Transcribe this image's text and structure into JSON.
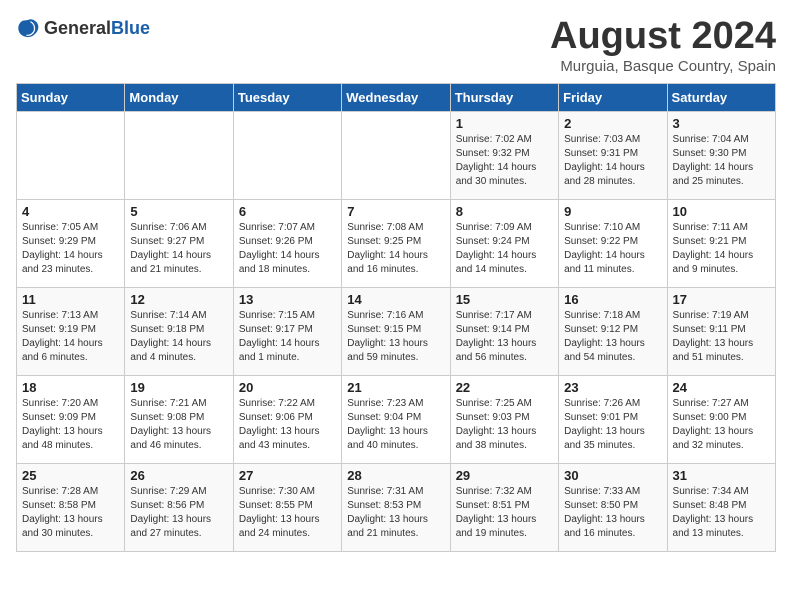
{
  "logo": {
    "general": "General",
    "blue": "Blue"
  },
  "title": "August 2024",
  "subtitle": "Murguia, Basque Country, Spain",
  "days_of_week": [
    "Sunday",
    "Monday",
    "Tuesday",
    "Wednesday",
    "Thursday",
    "Friday",
    "Saturday"
  ],
  "weeks": [
    [
      {
        "day": "",
        "sunrise": "",
        "sunset": "",
        "daylight": ""
      },
      {
        "day": "",
        "sunrise": "",
        "sunset": "",
        "daylight": ""
      },
      {
        "day": "",
        "sunrise": "",
        "sunset": "",
        "daylight": ""
      },
      {
        "day": "",
        "sunrise": "",
        "sunset": "",
        "daylight": ""
      },
      {
        "day": "1",
        "sunrise": "Sunrise: 7:02 AM",
        "sunset": "Sunset: 9:32 PM",
        "daylight": "Daylight: 14 hours and 30 minutes."
      },
      {
        "day": "2",
        "sunrise": "Sunrise: 7:03 AM",
        "sunset": "Sunset: 9:31 PM",
        "daylight": "Daylight: 14 hours and 28 minutes."
      },
      {
        "day": "3",
        "sunrise": "Sunrise: 7:04 AM",
        "sunset": "Sunset: 9:30 PM",
        "daylight": "Daylight: 14 hours and 25 minutes."
      }
    ],
    [
      {
        "day": "4",
        "sunrise": "Sunrise: 7:05 AM",
        "sunset": "Sunset: 9:29 PM",
        "daylight": "Daylight: 14 hours and 23 minutes."
      },
      {
        "day": "5",
        "sunrise": "Sunrise: 7:06 AM",
        "sunset": "Sunset: 9:27 PM",
        "daylight": "Daylight: 14 hours and 21 minutes."
      },
      {
        "day": "6",
        "sunrise": "Sunrise: 7:07 AM",
        "sunset": "Sunset: 9:26 PM",
        "daylight": "Daylight: 14 hours and 18 minutes."
      },
      {
        "day": "7",
        "sunrise": "Sunrise: 7:08 AM",
        "sunset": "Sunset: 9:25 PM",
        "daylight": "Daylight: 14 hours and 16 minutes."
      },
      {
        "day": "8",
        "sunrise": "Sunrise: 7:09 AM",
        "sunset": "Sunset: 9:24 PM",
        "daylight": "Daylight: 14 hours and 14 minutes."
      },
      {
        "day": "9",
        "sunrise": "Sunrise: 7:10 AM",
        "sunset": "Sunset: 9:22 PM",
        "daylight": "Daylight: 14 hours and 11 minutes."
      },
      {
        "day": "10",
        "sunrise": "Sunrise: 7:11 AM",
        "sunset": "Sunset: 9:21 PM",
        "daylight": "Daylight: 14 hours and 9 minutes."
      }
    ],
    [
      {
        "day": "11",
        "sunrise": "Sunrise: 7:13 AM",
        "sunset": "Sunset: 9:19 PM",
        "daylight": "Daylight: 14 hours and 6 minutes."
      },
      {
        "day": "12",
        "sunrise": "Sunrise: 7:14 AM",
        "sunset": "Sunset: 9:18 PM",
        "daylight": "Daylight: 14 hours and 4 minutes."
      },
      {
        "day": "13",
        "sunrise": "Sunrise: 7:15 AM",
        "sunset": "Sunset: 9:17 PM",
        "daylight": "Daylight: 14 hours and 1 minute."
      },
      {
        "day": "14",
        "sunrise": "Sunrise: 7:16 AM",
        "sunset": "Sunset: 9:15 PM",
        "daylight": "Daylight: 13 hours and 59 minutes."
      },
      {
        "day": "15",
        "sunrise": "Sunrise: 7:17 AM",
        "sunset": "Sunset: 9:14 PM",
        "daylight": "Daylight: 13 hours and 56 minutes."
      },
      {
        "day": "16",
        "sunrise": "Sunrise: 7:18 AM",
        "sunset": "Sunset: 9:12 PM",
        "daylight": "Daylight: 13 hours and 54 minutes."
      },
      {
        "day": "17",
        "sunrise": "Sunrise: 7:19 AM",
        "sunset": "Sunset: 9:11 PM",
        "daylight": "Daylight: 13 hours and 51 minutes."
      }
    ],
    [
      {
        "day": "18",
        "sunrise": "Sunrise: 7:20 AM",
        "sunset": "Sunset: 9:09 PM",
        "daylight": "Daylight: 13 hours and 48 minutes."
      },
      {
        "day": "19",
        "sunrise": "Sunrise: 7:21 AM",
        "sunset": "Sunset: 9:08 PM",
        "daylight": "Daylight: 13 hours and 46 minutes."
      },
      {
        "day": "20",
        "sunrise": "Sunrise: 7:22 AM",
        "sunset": "Sunset: 9:06 PM",
        "daylight": "Daylight: 13 hours and 43 minutes."
      },
      {
        "day": "21",
        "sunrise": "Sunrise: 7:23 AM",
        "sunset": "Sunset: 9:04 PM",
        "daylight": "Daylight: 13 hours and 40 minutes."
      },
      {
        "day": "22",
        "sunrise": "Sunrise: 7:25 AM",
        "sunset": "Sunset: 9:03 PM",
        "daylight": "Daylight: 13 hours and 38 minutes."
      },
      {
        "day": "23",
        "sunrise": "Sunrise: 7:26 AM",
        "sunset": "Sunset: 9:01 PM",
        "daylight": "Daylight: 13 hours and 35 minutes."
      },
      {
        "day": "24",
        "sunrise": "Sunrise: 7:27 AM",
        "sunset": "Sunset: 9:00 PM",
        "daylight": "Daylight: 13 hours and 32 minutes."
      }
    ],
    [
      {
        "day": "25",
        "sunrise": "Sunrise: 7:28 AM",
        "sunset": "Sunset: 8:58 PM",
        "daylight": "Daylight: 13 hours and 30 minutes."
      },
      {
        "day": "26",
        "sunrise": "Sunrise: 7:29 AM",
        "sunset": "Sunset: 8:56 PM",
        "daylight": "Daylight: 13 hours and 27 minutes."
      },
      {
        "day": "27",
        "sunrise": "Sunrise: 7:30 AM",
        "sunset": "Sunset: 8:55 PM",
        "daylight": "Daylight: 13 hours and 24 minutes."
      },
      {
        "day": "28",
        "sunrise": "Sunrise: 7:31 AM",
        "sunset": "Sunset: 8:53 PM",
        "daylight": "Daylight: 13 hours and 21 minutes."
      },
      {
        "day": "29",
        "sunrise": "Sunrise: 7:32 AM",
        "sunset": "Sunset: 8:51 PM",
        "daylight": "Daylight: 13 hours and 19 minutes."
      },
      {
        "day": "30",
        "sunrise": "Sunrise: 7:33 AM",
        "sunset": "Sunset: 8:50 PM",
        "daylight": "Daylight: 13 hours and 16 minutes."
      },
      {
        "day": "31",
        "sunrise": "Sunrise: 7:34 AM",
        "sunset": "Sunset: 8:48 PM",
        "daylight": "Daylight: 13 hours and 13 minutes."
      }
    ]
  ]
}
